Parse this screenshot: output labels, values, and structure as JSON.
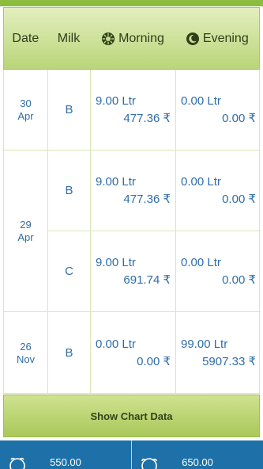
{
  "header": {
    "date_label": "Date",
    "milk_label": "Milk",
    "morning_label": "Morning",
    "evening_label": "Evening",
    "morning_icon": "sun-icon",
    "evening_icon": "moon-icon"
  },
  "rows": [
    {
      "date_day": "30",
      "date_month": "Apr",
      "entries": [
        {
          "milk": "B",
          "morning_qty": "9.00 Ltr",
          "morning_amt": "477.36 ₹",
          "evening_qty": "0.00 Ltr",
          "evening_amt": "0.00 ₹"
        }
      ]
    },
    {
      "date_day": "29",
      "date_month": "Apr",
      "entries": [
        {
          "milk": "B",
          "morning_qty": "9.00 Ltr",
          "morning_amt": "477.36 ₹",
          "evening_qty": "0.00 Ltr",
          "evening_amt": "0.00 ₹"
        },
        {
          "milk": "C",
          "morning_qty": "9.00 Ltr",
          "morning_amt": "691.74 ₹",
          "evening_qty": "0.00 Ltr",
          "evening_amt": "0.00 ₹"
        }
      ]
    },
    {
      "date_day": "26",
      "date_month": "Nov",
      "entries": [
        {
          "milk": "B",
          "morning_qty": "0.00 Ltr",
          "morning_amt": "0.00 ₹",
          "evening_qty": "99.00 Ltr",
          "evening_amt": "5907.33 ₹"
        }
      ]
    }
  ],
  "chart_button_label": "Show Chart Data",
  "footer": {
    "left_value": "550.00",
    "right_value": "650.00",
    "left_icon": "cow-icon",
    "right_icon": "buffalo-icon"
  },
  "colors": {
    "top_accent": "#8cbd3f",
    "header_bg": "#c6de8c",
    "value_text": "#2f6da8",
    "footer_bg": "#1d70a8"
  }
}
